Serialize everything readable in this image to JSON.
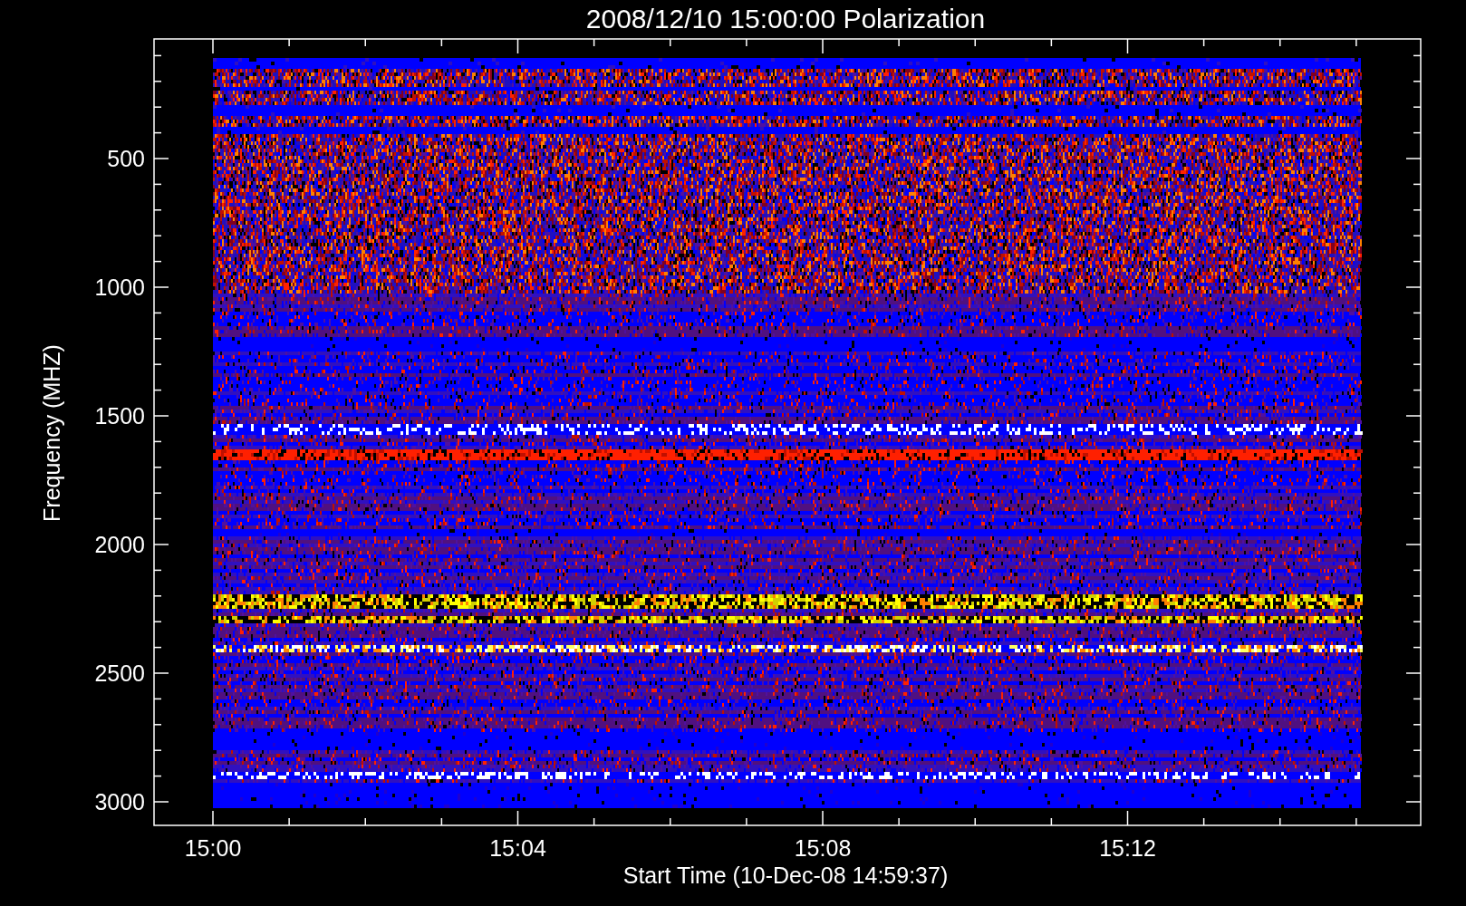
{
  "title": "2008/12/10 15:00:00 Polarization",
  "plot": {
    "y_axis": {
      "label": "Frequency (MHZ)",
      "ticks": [
        "500",
        "1000",
        "1500",
        "2000",
        "2500",
        "3000"
      ]
    },
    "x_axis": {
      "label": "Start Time (10-Dec-08 14:59:37)",
      "ticks": [
        "15:00",
        "15:04",
        "15:08",
        "15:12"
      ]
    }
  }
}
